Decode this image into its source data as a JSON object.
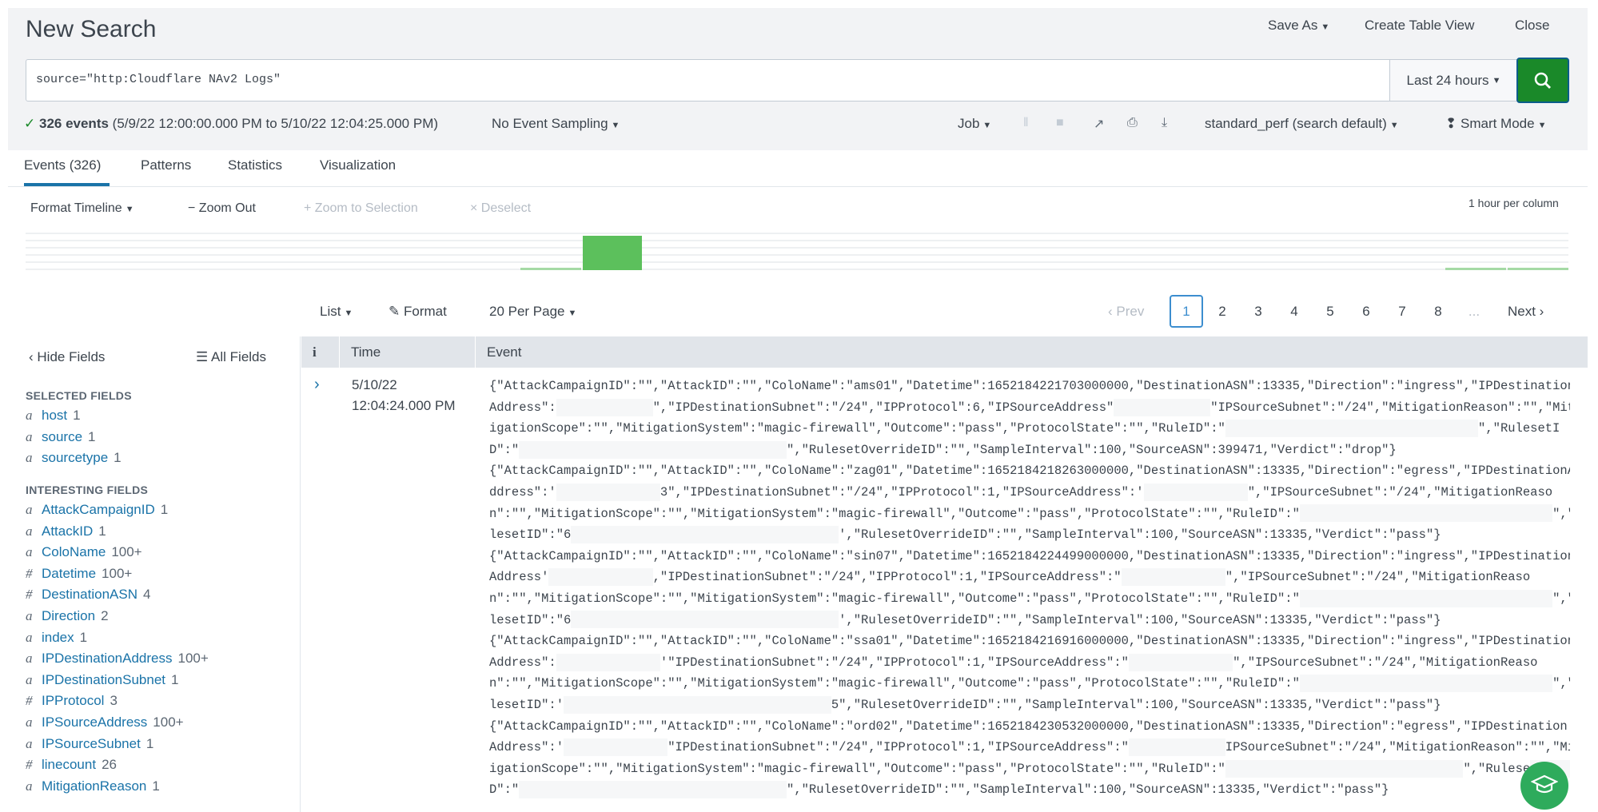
{
  "header": {
    "title": "New Search",
    "save_as": "Save As",
    "create_table_view": "Create Table View",
    "close": "Close"
  },
  "search": {
    "query": "source=\"http:Cloudflare NAv2 Logs\"",
    "time_range": "Last 24 hours"
  },
  "status": {
    "check": "✓",
    "count": "326 events",
    "range": "(5/9/22 12:00:00.000 PM to 5/10/22 12:04:25.000 PM)",
    "sampling": "No Event Sampling",
    "job": "Job",
    "perf": "standard_perf (search default)",
    "mode": "Smart Mode"
  },
  "tabs": [
    {
      "label": "Events (326)",
      "active": true
    },
    {
      "label": "Patterns"
    },
    {
      "label": "Statistics"
    },
    {
      "label": "Visualization"
    }
  ],
  "timeline": {
    "format": "Format Timeline",
    "zoom_out": "− Zoom Out",
    "zoom_sel": "+ Zoom to Selection",
    "deselect": "× Deselect",
    "scale": "1 hour per column",
    "bar_color": "#5cc05c"
  },
  "results": {
    "list": "List",
    "format": "Format",
    "per_page": "20 Per Page",
    "prev": "‹ Prev",
    "next": "Next ›",
    "pages": [
      "1",
      "2",
      "3",
      "4",
      "5",
      "6",
      "7",
      "8"
    ],
    "ellipsis": "...",
    "current_page": "1"
  },
  "sidebar": {
    "hide": "‹ Hide Fields",
    "all": "All Fields",
    "selected_title": "SELECTED FIELDS",
    "interesting_title": "INTERESTING FIELDS",
    "selected": [
      {
        "t": "a",
        "name": "host",
        "count": "1"
      },
      {
        "t": "a",
        "name": "source",
        "count": "1"
      },
      {
        "t": "a",
        "name": "sourcetype",
        "count": "1"
      }
    ],
    "interesting": [
      {
        "t": "a",
        "name": "AttackCampaignID",
        "count": "1"
      },
      {
        "t": "a",
        "name": "AttackID",
        "count": "1"
      },
      {
        "t": "a",
        "name": "ColoName",
        "count": "100+"
      },
      {
        "t": "#",
        "name": "Datetime",
        "count": "100+"
      },
      {
        "t": "#",
        "name": "DestinationASN",
        "count": "4"
      },
      {
        "t": "a",
        "name": "Direction",
        "count": "2"
      },
      {
        "t": "a",
        "name": "index",
        "count": "1"
      },
      {
        "t": "a",
        "name": "IPDestinationAddress",
        "count": "100+"
      },
      {
        "t": "a",
        "name": "IPDestinationSubnet",
        "count": "1"
      },
      {
        "t": "#",
        "name": "IPProtocol",
        "count": "3"
      },
      {
        "t": "a",
        "name": "IPSourceAddress",
        "count": "100+"
      },
      {
        "t": "a",
        "name": "IPSourceSubnet",
        "count": "1"
      },
      {
        "t": "#",
        "name": "linecount",
        "count": "26"
      },
      {
        "t": "a",
        "name": "MitigationReason",
        "count": "1"
      }
    ]
  },
  "table": {
    "col_i": "i",
    "col_time": "Time",
    "col_event": "Event",
    "time_date": "5/10/22",
    "time_clock": "12:04:24.000 PM",
    "lines": [
      [
        "{\"AttackCampaignID\":\"\",\"AttackID\":\"\",\"ColoName\":\"ams01\",\"Datetime\":1652184221703000000,\"DestinationASN\":13335,\"Direction\":\"ingress\",\"IPDestination"
      ],
      [
        "Address\":",
        "\",\"IPDestinationSubnet\":\"/24\",\"IPProtocol\":6,\"IPSourceAddress\"",
        "\"IPSourceSubnet\":\"/24\",\"MitigationReason\":\"\",\"Mit"
      ],
      [
        "igationScope\":\"\",\"MitigationSystem\":\"magic-firewall\",\"Outcome\":\"pass\",\"ProtocolState\":\"\",\"RuleID\":\"",
        "\",\"RulesetI"
      ],
      [
        "D\":\"",
        "\",\"RulesetOverrideID\":\"\",\"SampleInterval\":100,\"SourceASN\":399471,\"Verdict\":\"drop\"}"
      ],
      [
        "{\"AttackCampaignID\":\"\",\"AttackID\":\"\",\"ColoName\":\"zag01\",\"Datetime\":1652184218263000000,\"DestinationASN\":13335,\"Direction\":\"egress\",\"IPDestinationA"
      ],
      [
        "ddress\":'",
        "3\",\"IPDestinationSubnet\":\"/24\",\"IPProtocol\":1,\"IPSourceAddress\":'",
        "\",\"IPSourceSubnet\":\"/24\",\"MitigationReaso"
      ],
      [
        "n\":\"\",\"MitigationScope\":\"\",\"MitigationSystem\":\"magic-firewall\",\"Outcome\":\"pass\",\"ProtocolState\":\"\",\"RuleID\":\"",
        "\",\"Ru"
      ],
      [
        "lesetID\":\"6",
        "',\"RulesetOverrideID\":\"\",\"SampleInterval\":100,\"SourceASN\":13335,\"Verdict\":\"pass\"}"
      ],
      [
        "{\"AttackCampaignID\":\"\",\"AttackID\":\"\",\"ColoName\":\"sin07\",\"Datetime\":1652184224499000000,\"DestinationASN\":13335,\"Direction\":\"ingress\",\"IPDestination"
      ],
      [
        "Address'",
        ",\"IPDestinationSubnet\":\"/24\",\"IPProtocol\":1,\"IPSourceAddress\":\"",
        "\",\"IPSourceSubnet\":\"/24\",\"MitigationReaso"
      ],
      [
        "n\":\"\",\"MitigationScope\":\"\",\"MitigationSystem\":\"magic-firewall\",\"Outcome\":\"pass\",\"ProtocolState\":\"\",\"RuleID\":\"",
        "\",\"Ru"
      ],
      [
        "lesetID\":\"6",
        "',\"RulesetOverrideID\":\"\",\"SampleInterval\":100,\"SourceASN\":13335,\"Verdict\":\"pass\"}"
      ],
      [
        "{\"AttackCampaignID\":\"\",\"AttackID\":\"\",\"ColoName\":\"ssa01\",\"Datetime\":1652184216916000000,\"DestinationASN\":13335,\"Direction\":\"ingress\",\"IPDestination"
      ],
      [
        "Address\":",
        "'\"IPDestinationSubnet\":\"/24\",\"IPProtocol\":1,\"IPSourceAddress\":\"",
        "\",\"IPSourceSubnet\":\"/24\",\"MitigationReaso"
      ],
      [
        "n\":\"\",\"MitigationScope\":\"\",\"MitigationSystem\":\"magic-firewall\",\"Outcome\":\"pass\",\"ProtocolState\":\"\",\"RuleID\":\"",
        "\",\"Ru"
      ],
      [
        "lesetID\":'",
        "5\",\"RulesetOverrideID\":\"\",\"SampleInterval\":100,\"SourceASN\":13335,\"Verdict\":\"pass\"}"
      ],
      [
        "{\"AttackCampaignID\":\"\",\"AttackID\":\"\",\"ColoName\":\"ord02\",\"Datetime\":1652184230532000000,\"DestinationASN\":13335,\"Direction\":\"egress\",\"IPDestination"
      ],
      [
        "Address\":'",
        "\"IPDestinationSubnet\":\"/24\",\"IPProtocol\":1,\"IPSourceAddress\":\"",
        "IPSourceSubnet\":\"/24\",\"MitigationReason\":\"\",\"Mit"
      ],
      [
        "igationScope\":\"\",\"MitigationSystem\":\"magic-firewall\",\"Outcome\":\"pass\",\"ProtocolState\":\"\",\"RuleID\":\"",
        "\",\"Rulese"
      ],
      [
        "D\":\"",
        "\",\"RulesetOverrideID\":\"\",\"SampleInterval\":100,\"SourceASN\":13335,\"Verdict\":\"pass\"}"
      ]
    ]
  },
  "colors": {
    "accent": "#1a73a8",
    "search_button": "#1a8929",
    "help": "#2eab5c"
  }
}
